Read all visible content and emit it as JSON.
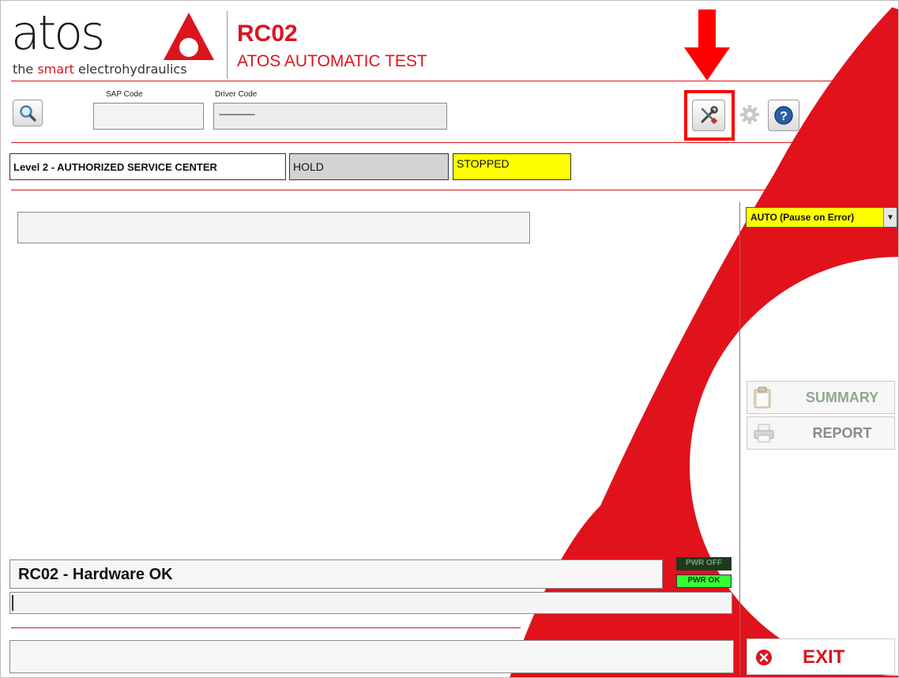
{
  "brand": {
    "logo_text": "atos",
    "tagline_pre": "the ",
    "tagline_smart": "smart",
    "tagline_post": " electrohydraulics"
  },
  "header": {
    "title": "RC02",
    "subtitle": "ATOS AUTOMATIC TEST"
  },
  "toolbar": {
    "sap_label": "SAP Code",
    "sap_value": "",
    "driver_label": "Driver Code",
    "driver_value": "---------------",
    "search_icon": "magnifier-icon",
    "tools_icon": "wrench-screwdriver-icon",
    "settings_icon": "gear-icon",
    "help_icon": "help-icon"
  },
  "status": {
    "level": "Level 2 - AUTHORIZED SERVICE CENTER",
    "mode": "HOLD",
    "state": "STOPPED"
  },
  "main": {
    "info_field": "",
    "result_text": "RC02 - Hardware OK",
    "progress_text": "",
    "message_field": ""
  },
  "indicators": {
    "pwr_off": "PWR OFF",
    "pwr_ok": "PWR OK"
  },
  "side": {
    "run_mode": "AUTO (Pause on Error)",
    "summary_label": "SUMMARY",
    "report_label": "REPORT",
    "exit_label": "EXIT"
  },
  "colors": {
    "brand_red": "#d9151e",
    "status_yellow": "#ffff00",
    "led_green": "#33ff33",
    "hold_gray": "#d3d3d3"
  }
}
